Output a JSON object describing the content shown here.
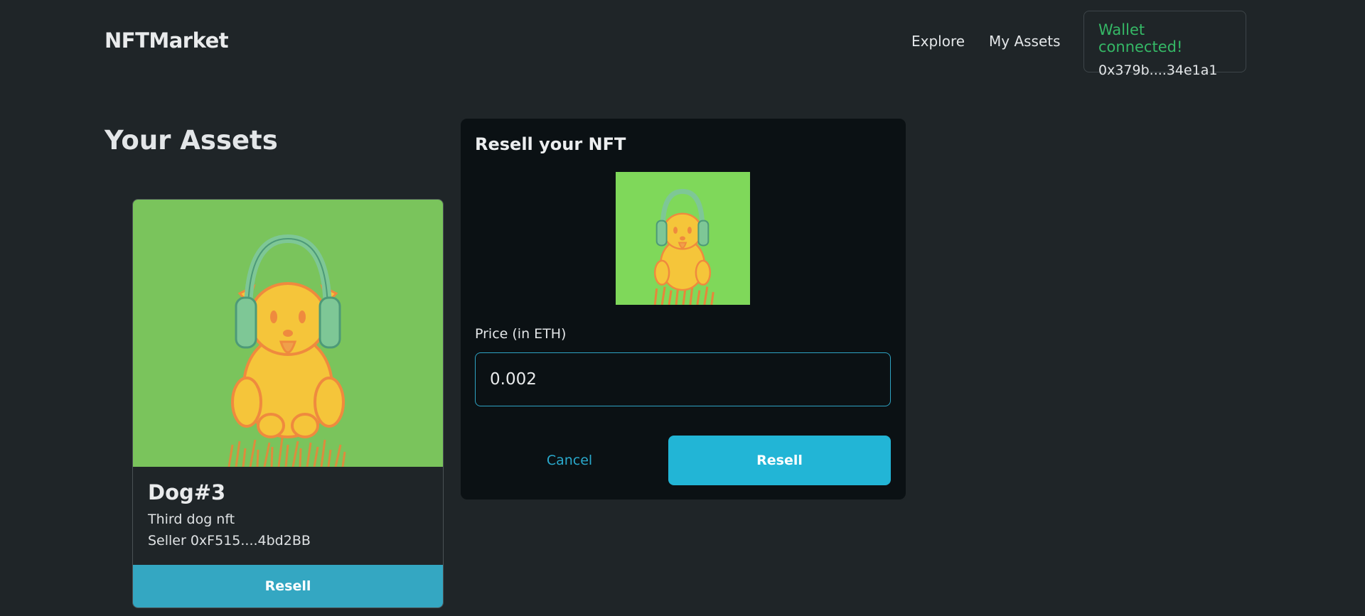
{
  "header": {
    "brand": "NFTMarket",
    "nav": {
      "explore": "Explore",
      "my_assets": "My Assets"
    },
    "wallet": {
      "status": "Wallet connected!",
      "address": "0x379b....34e1a1"
    }
  },
  "main": {
    "title": "Your Assets",
    "card": {
      "image_icon": "dog-with-headphones-icon",
      "name": "Dog#3",
      "description": "Third dog nft",
      "seller": "Seller 0xF515....4bd2BB",
      "button": "Resell"
    }
  },
  "modal": {
    "title": "Resell your NFT",
    "image_icon": "dog-with-headphones-icon",
    "price_label": "Price (in ETH)",
    "price_value": "0.002",
    "cancel": "Cancel",
    "submit": "Resell"
  },
  "colors": {
    "background": "#1f2528",
    "modal_background": "#0b1114",
    "accent": "#22b5d6",
    "wallet_status": "#35b866",
    "nft_background": "#7ac45c"
  }
}
